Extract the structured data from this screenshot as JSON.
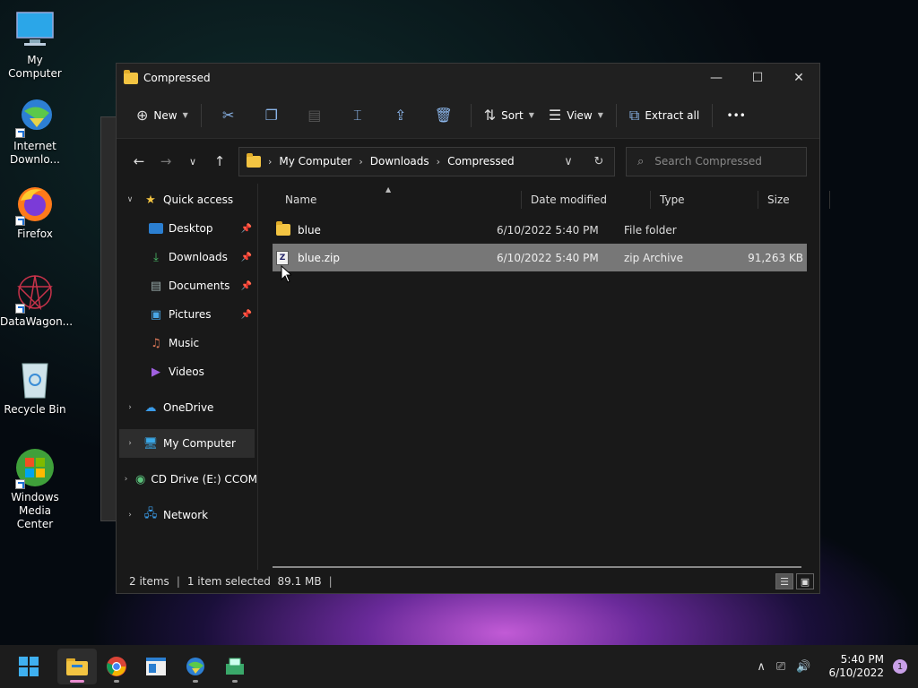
{
  "desktop": {
    "icons": [
      {
        "label": "My Computer",
        "icon": "monitor-icon"
      },
      {
        "label": "Internet Downlo...",
        "icon": "idm-icon"
      },
      {
        "label": "Firefox",
        "icon": "firefox-icon"
      },
      {
        "label": "DataWagon...",
        "icon": "datawagon-icon"
      },
      {
        "label": "Recycle Bin",
        "icon": "recycle-bin-icon"
      },
      {
        "label": "Windows Media Center",
        "icon": "wmc-icon"
      }
    ]
  },
  "window": {
    "title": "Compressed",
    "controls": {
      "minimize": "—",
      "maximize": "☐",
      "close": "✕"
    }
  },
  "commandbar": {
    "new_label": "New",
    "sort_label": "Sort",
    "view_label": "View",
    "extract_label": "Extract all",
    "more_label": "•••"
  },
  "address": {
    "crumbs": [
      "My Computer",
      "Downloads",
      "Compressed"
    ],
    "search_placeholder": "Search Compressed"
  },
  "nav": {
    "quick_access": "Quick access",
    "items": [
      "Desktop",
      "Downloads",
      "Documents",
      "Pictures",
      "Music",
      "Videos"
    ],
    "onedrive": "OneDrive",
    "my_computer": "My Computer",
    "cd_drive": "CD Drive (E:) CCOM",
    "network": "Network"
  },
  "columns": {
    "name": "Name",
    "date": "Date modified",
    "type": "Type",
    "size": "Size"
  },
  "files": [
    {
      "name": "blue",
      "date": "6/10/2022 5:40 PM",
      "type": "File folder",
      "size": ""
    },
    {
      "name": "blue.zip",
      "date": "6/10/2022 5:40 PM",
      "type": "zip Archive",
      "size": "91,263 KB"
    }
  ],
  "status": {
    "items": "2 items",
    "selected": "1 item selected  89.1 MB"
  },
  "taskbar": {
    "time": "5:40 PM",
    "date": "6/10/2022",
    "notifications": "1"
  },
  "colors": {
    "accent": "#60cdff",
    "selection": "#777777",
    "folder": "#f3c442"
  }
}
